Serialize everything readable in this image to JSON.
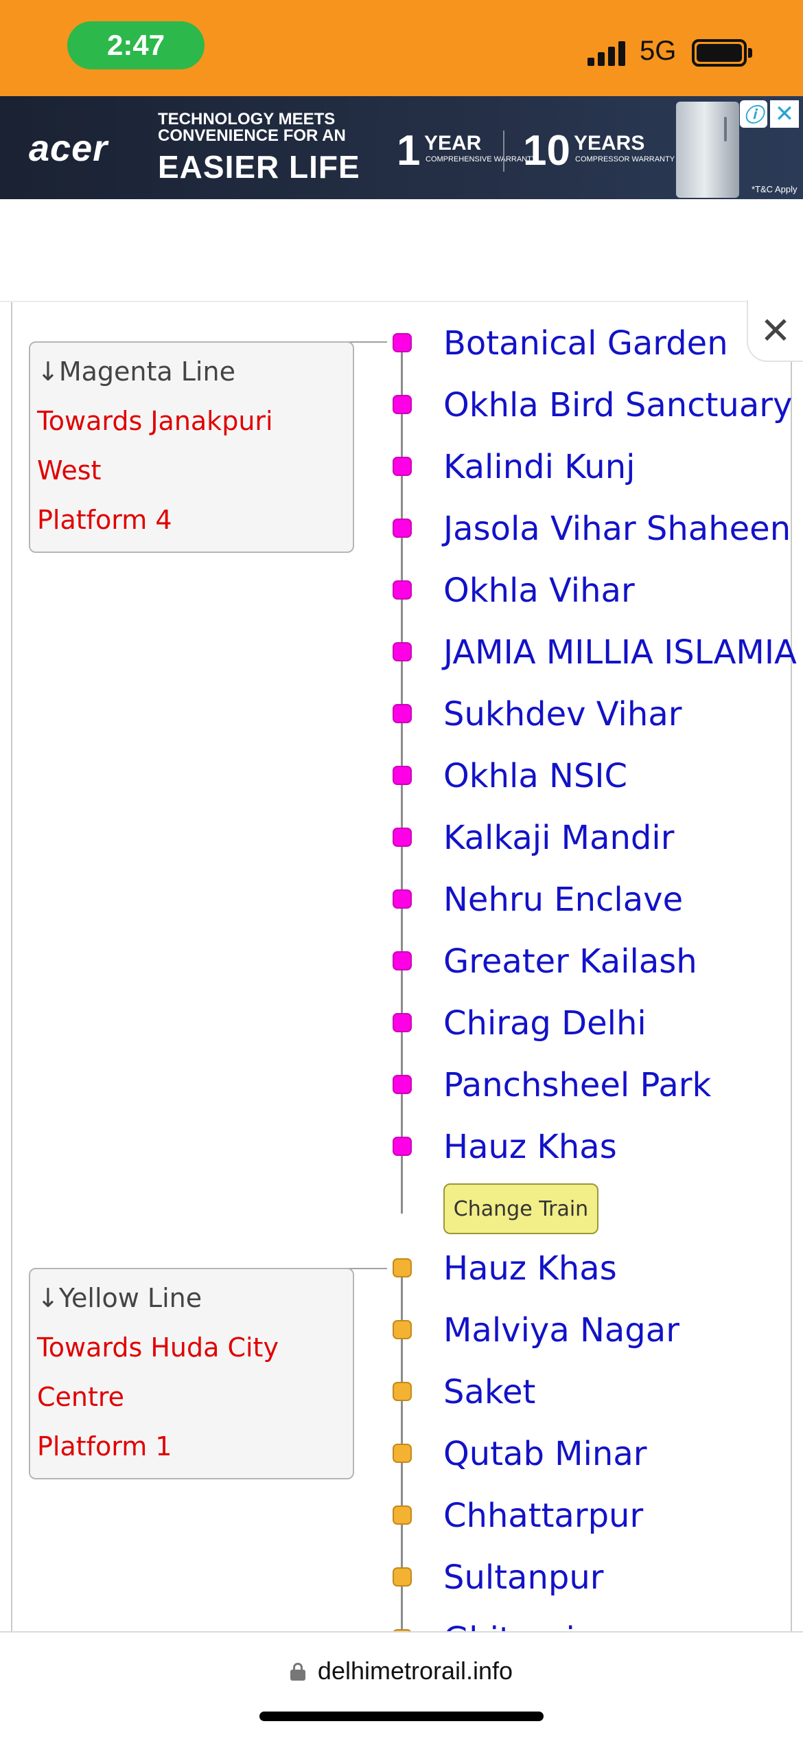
{
  "status_bar": {
    "time": "2:47",
    "network": "5G"
  },
  "ad": {
    "brand": "acer",
    "tagline_1": "TECHNOLOGY MEETS",
    "tagline_2": "CONVENIENCE FOR AN",
    "tagline_3": "EASIER LIFE",
    "warranty_1_number": "1",
    "warranty_1_unit": "YEAR",
    "warranty_1_sub": "COMPREHENSIVE WARRANTY",
    "warranty_2_number": "10",
    "warranty_2_unit": "YEARS",
    "warranty_2_sub": "COMPRESSOR WARRANTY",
    "terms": "*T&C Apply",
    "info_icon": "ⓘ",
    "close_icon": "✕"
  },
  "close_icon": "✕",
  "segments": [
    {
      "line": "↓Magenta Line",
      "towards_1": "Towards Janakpuri",
      "towards_2": "West",
      "platform": "Platform 4",
      "color": "#ff00e6",
      "stations": [
        "Botanical Garden",
        "Okhla Bird Sanctuary",
        "Kalindi Kunj",
        "Jasola Vihar Shaheen Bagh",
        "Okhla Vihar",
        "JAMIA MILLIA ISLAMIA",
        "Sukhdev Vihar",
        "Okhla NSIC",
        "Kalkaji Mandir",
        "Nehru Enclave",
        "Greater Kailash",
        "Chirag Delhi",
        "Panchsheel Park",
        "Hauz Khas"
      ],
      "change_label": "Change Train"
    },
    {
      "line": "↓Yellow Line",
      "towards_1": "Towards Huda City",
      "towards_2": "Centre",
      "platform": "Platform 1",
      "color": "#f4b233",
      "stations": [
        "Hauz Khas",
        "Malviya Nagar",
        "Saket",
        "Qutab Minar",
        "Chhattarpur",
        "Sultanpur",
        "Ghitorni"
      ]
    }
  ],
  "browser": {
    "url": "delhimetrorail.info"
  }
}
